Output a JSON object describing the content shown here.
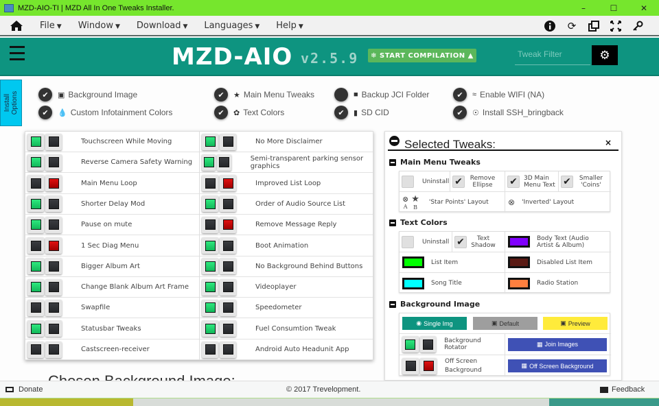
{
  "window": {
    "title": "MZD-AIO-TI | MZD All In One Tweaks Installer.",
    "controls": [
      "minimize",
      "maximize",
      "close"
    ]
  },
  "menubar": {
    "items": [
      {
        "label": "File"
      },
      {
        "label": "Window"
      },
      {
        "label": "Download"
      },
      {
        "label": "Languages"
      },
      {
        "label": "Help"
      }
    ],
    "tools": [
      "info-icon",
      "refresh-icon",
      "restore-window-icon",
      "fullscreen-icon",
      "key-icon"
    ]
  },
  "header": {
    "logo": "MZD-AIO",
    "version": "v2.5.9",
    "start_button": "START COMPILATION",
    "filter_placeholder": "Tweak Filter"
  },
  "install_tab": {
    "line1": "Install",
    "line2": "Options"
  },
  "install_options": [
    {
      "label": "Background Image",
      "icon": "image-icon",
      "checked": true
    },
    {
      "label": "Custom Infotainment Colors",
      "icon": "drop-icon",
      "checked": true
    },
    {
      "label": "Main Menu Tweaks",
      "icon": "star-icon",
      "checked": true
    },
    {
      "label": "Text Colors",
      "icon": "palette-icon",
      "checked": true
    },
    {
      "label": "Backup JCI Folder",
      "icon": "save-icon",
      "checked": false
    },
    {
      "label": "SD CID",
      "icon": "sd-card-icon",
      "checked": true
    },
    {
      "label": "Enable WIFI (NA)",
      "icon": "wifi-icon",
      "checked": true
    },
    {
      "label": "Install SSH_bringback",
      "icon": "antenna-icon",
      "checked": true
    }
  ],
  "tweaks": {
    "left": [
      {
        "label": "Touchscreen While Moving",
        "install": true,
        "uninstall": false
      },
      {
        "label": "Reverse Camera Safety Warning",
        "install": true,
        "uninstall": false
      },
      {
        "label": "Main Menu Loop",
        "install": false,
        "uninstall": true
      },
      {
        "label": "Shorter Delay Mod",
        "install": true,
        "uninstall": false
      },
      {
        "label": "Pause on mute",
        "install": true,
        "uninstall": false
      },
      {
        "label": "1 Sec Diag Menu",
        "install": false,
        "uninstall": true
      },
      {
        "label": "Bigger Album Art",
        "install": true,
        "uninstall": false
      },
      {
        "label": "Change Blank Album Art Frame",
        "install": true,
        "uninstall": false
      },
      {
        "label": "Swapfile",
        "install": false,
        "uninstall": false
      },
      {
        "label": "Statusbar Tweaks",
        "install": true,
        "uninstall": false
      },
      {
        "label": "Castscreen-receiver",
        "install": false,
        "uninstall": false
      }
    ],
    "right": [
      {
        "label": "No More Disclaimer",
        "install": true,
        "uninstall": false
      },
      {
        "label": "Semi-transparent parking sensor graphics",
        "install": true,
        "uninstall": false
      },
      {
        "label": "Improved List Loop",
        "install": false,
        "uninstall": true
      },
      {
        "label": "Order of Audio Source List",
        "install": true,
        "uninstall": false
      },
      {
        "label": "Remove Message Reply",
        "install": false,
        "uninstall": true
      },
      {
        "label": "Boot Animation",
        "install": true,
        "uninstall": false
      },
      {
        "label": "No Background Behind Buttons",
        "install": true,
        "uninstall": false
      },
      {
        "label": "Videoplayer",
        "install": true,
        "uninstall": false
      },
      {
        "label": "Speedometer",
        "install": true,
        "uninstall": false
      },
      {
        "label": "Fuel Consumtion Tweak",
        "install": true,
        "uninstall": false
      },
      {
        "label": "Android Auto Headunit App",
        "install": false,
        "uninstall": false
      }
    ]
  },
  "chosen_bg_heading": "Chosen Background Image:",
  "selected": {
    "title": "Selected Tweaks:",
    "close": "×",
    "main_menu": {
      "heading": "Main Menu Tweaks",
      "options": [
        {
          "label": "Uninstall",
          "checked": false
        },
        {
          "label": "Remove Ellipse",
          "checked": true
        },
        {
          "label": "3D Main Menu Text",
          "checked": true
        },
        {
          "label": "Smaller 'Coins'",
          "checked": true
        }
      ],
      "layout_a_label": "A",
      "layout_b_label": "B",
      "star_points": "'Star Points' Layout",
      "inverted": "'Inverted' Layout"
    },
    "text_colors": {
      "heading": "Text Colors",
      "uninstall": {
        "label": "Uninstall",
        "checked": false
      },
      "text_shadow": {
        "label": "Text Shadow",
        "checked": true
      },
      "colors": [
        {
          "label": "Body Text (Audio Artist & Album)",
          "color": "#8000ff"
        },
        {
          "label": "List Item",
          "color": "#00ff00"
        },
        {
          "label": "Disabled List Item",
          "color": "#5a1a14"
        },
        {
          "label": "Song Title",
          "color": "#00ffff"
        },
        {
          "label": "Radio Station",
          "color": "#ff7f3f"
        }
      ]
    },
    "background": {
      "heading": "Background Image",
      "single_img": "Single Img",
      "default": "Default",
      "preview": "Preview",
      "rotator": {
        "label": "Background Rotator",
        "install": true,
        "uninstall": false
      },
      "offscreen": {
        "label": "Off Screen Background",
        "install": false,
        "uninstall": true
      },
      "join_images": "Join Images",
      "offscreen_btn": "Off Screen Background"
    }
  },
  "footer": {
    "donate": "Donate",
    "copyright": "© 2017 Trevelopment.",
    "feedback": "Feedback"
  },
  "colors": {
    "titlebar": "#76e62d",
    "header": "#0e9480",
    "start_button": "#5bb75b",
    "install_tab": "#00c8f0",
    "single_img": "#0e9480",
    "default": "#9e9e9e",
    "preview": "#ffeb3b",
    "indigo_button": "#3f51b5"
  }
}
